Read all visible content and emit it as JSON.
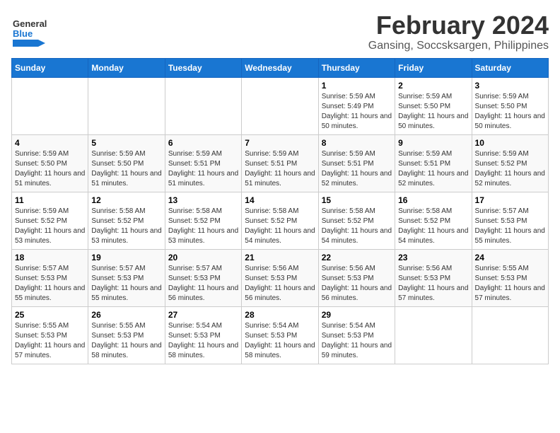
{
  "logo": {
    "general": "General",
    "blue": "Blue"
  },
  "title": "February 2024",
  "subtitle": "Gansing, Soccsksargen, Philippines",
  "days_of_week": [
    "Sunday",
    "Monday",
    "Tuesday",
    "Wednesday",
    "Thursday",
    "Friday",
    "Saturday"
  ],
  "weeks": [
    [
      {
        "day": "",
        "info": ""
      },
      {
        "day": "",
        "info": ""
      },
      {
        "day": "",
        "info": ""
      },
      {
        "day": "",
        "info": ""
      },
      {
        "day": "1",
        "info": "Sunrise: 5:59 AM\nSunset: 5:49 PM\nDaylight: 11 hours and 50 minutes."
      },
      {
        "day": "2",
        "info": "Sunrise: 5:59 AM\nSunset: 5:50 PM\nDaylight: 11 hours and 50 minutes."
      },
      {
        "day": "3",
        "info": "Sunrise: 5:59 AM\nSunset: 5:50 PM\nDaylight: 11 hours and 50 minutes."
      }
    ],
    [
      {
        "day": "4",
        "info": "Sunrise: 5:59 AM\nSunset: 5:50 PM\nDaylight: 11 hours and 51 minutes."
      },
      {
        "day": "5",
        "info": "Sunrise: 5:59 AM\nSunset: 5:50 PM\nDaylight: 11 hours and 51 minutes."
      },
      {
        "day": "6",
        "info": "Sunrise: 5:59 AM\nSunset: 5:51 PM\nDaylight: 11 hours and 51 minutes."
      },
      {
        "day": "7",
        "info": "Sunrise: 5:59 AM\nSunset: 5:51 PM\nDaylight: 11 hours and 51 minutes."
      },
      {
        "day": "8",
        "info": "Sunrise: 5:59 AM\nSunset: 5:51 PM\nDaylight: 11 hours and 52 minutes."
      },
      {
        "day": "9",
        "info": "Sunrise: 5:59 AM\nSunset: 5:51 PM\nDaylight: 11 hours and 52 minutes."
      },
      {
        "day": "10",
        "info": "Sunrise: 5:59 AM\nSunset: 5:52 PM\nDaylight: 11 hours and 52 minutes."
      }
    ],
    [
      {
        "day": "11",
        "info": "Sunrise: 5:59 AM\nSunset: 5:52 PM\nDaylight: 11 hours and 53 minutes."
      },
      {
        "day": "12",
        "info": "Sunrise: 5:58 AM\nSunset: 5:52 PM\nDaylight: 11 hours and 53 minutes."
      },
      {
        "day": "13",
        "info": "Sunrise: 5:58 AM\nSunset: 5:52 PM\nDaylight: 11 hours and 53 minutes."
      },
      {
        "day": "14",
        "info": "Sunrise: 5:58 AM\nSunset: 5:52 PM\nDaylight: 11 hours and 54 minutes."
      },
      {
        "day": "15",
        "info": "Sunrise: 5:58 AM\nSunset: 5:52 PM\nDaylight: 11 hours and 54 minutes."
      },
      {
        "day": "16",
        "info": "Sunrise: 5:58 AM\nSunset: 5:52 PM\nDaylight: 11 hours and 54 minutes."
      },
      {
        "day": "17",
        "info": "Sunrise: 5:57 AM\nSunset: 5:53 PM\nDaylight: 11 hours and 55 minutes."
      }
    ],
    [
      {
        "day": "18",
        "info": "Sunrise: 5:57 AM\nSunset: 5:53 PM\nDaylight: 11 hours and 55 minutes."
      },
      {
        "day": "19",
        "info": "Sunrise: 5:57 AM\nSunset: 5:53 PM\nDaylight: 11 hours and 55 minutes."
      },
      {
        "day": "20",
        "info": "Sunrise: 5:57 AM\nSunset: 5:53 PM\nDaylight: 11 hours and 56 minutes."
      },
      {
        "day": "21",
        "info": "Sunrise: 5:56 AM\nSunset: 5:53 PM\nDaylight: 11 hours and 56 minutes."
      },
      {
        "day": "22",
        "info": "Sunrise: 5:56 AM\nSunset: 5:53 PM\nDaylight: 11 hours and 56 minutes."
      },
      {
        "day": "23",
        "info": "Sunrise: 5:56 AM\nSunset: 5:53 PM\nDaylight: 11 hours and 57 minutes."
      },
      {
        "day": "24",
        "info": "Sunrise: 5:55 AM\nSunset: 5:53 PM\nDaylight: 11 hours and 57 minutes."
      }
    ],
    [
      {
        "day": "25",
        "info": "Sunrise: 5:55 AM\nSunset: 5:53 PM\nDaylight: 11 hours and 57 minutes."
      },
      {
        "day": "26",
        "info": "Sunrise: 5:55 AM\nSunset: 5:53 PM\nDaylight: 11 hours and 58 minutes."
      },
      {
        "day": "27",
        "info": "Sunrise: 5:54 AM\nSunset: 5:53 PM\nDaylight: 11 hours and 58 minutes."
      },
      {
        "day": "28",
        "info": "Sunrise: 5:54 AM\nSunset: 5:53 PM\nDaylight: 11 hours and 58 minutes."
      },
      {
        "day": "29",
        "info": "Sunrise: 5:54 AM\nSunset: 5:53 PM\nDaylight: 11 hours and 59 minutes."
      },
      {
        "day": "",
        "info": ""
      },
      {
        "day": "",
        "info": ""
      }
    ]
  ]
}
